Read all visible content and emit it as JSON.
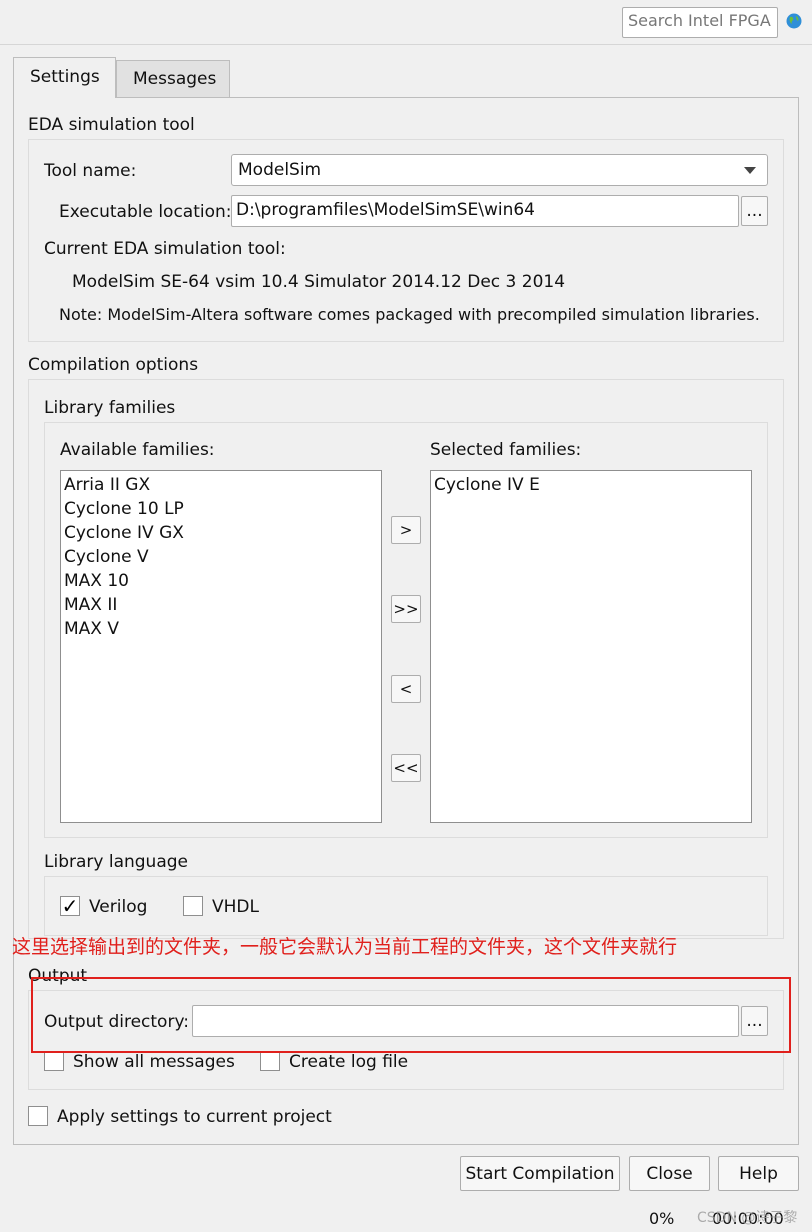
{
  "header": {
    "search_placeholder": "Search Intel FPGA"
  },
  "tabs": [
    {
      "label": "Settings",
      "active": true
    },
    {
      "label": "Messages",
      "active": false
    }
  ],
  "eda": {
    "title": "EDA simulation tool",
    "tool_name_label": "Tool name:",
    "tool_name_value": "ModelSim",
    "exec_label": "Executable location:",
    "exec_value": "D:\\programfiles\\ModelSimSE\\win64",
    "browse_label": "...",
    "current_label": "Current EDA simulation tool:",
    "current_value": "ModelSim SE-64 vsim 10.4 Simulator 2014.12 Dec  3 2014",
    "note": "Note: ModelSim-Altera software comes packaged with precompiled simulation libraries."
  },
  "compilation": {
    "title": "Compilation options",
    "library_families_title": "Library families",
    "available_label": "Available families:",
    "available": [
      "Arria II GX",
      "Cyclone 10 LP",
      "Cyclone IV GX",
      "Cyclone V",
      "MAX 10",
      "MAX II",
      "MAX V"
    ],
    "selected_label": "Selected families:",
    "selected": [
      "Cyclone IV E"
    ],
    "move_buttons": [
      ">",
      ">>",
      "<",
      "<<"
    ],
    "library_language_title": "Library language",
    "languages": [
      {
        "label": "Verilog",
        "checked": true
      },
      {
        "label": "VHDL",
        "checked": false
      }
    ]
  },
  "annotation": "这里选择输出到的文件夹，一般它会默认为当前工程的文件夹，这个文件夹就行",
  "output": {
    "title": "Output",
    "dir_label": "Output directory:",
    "dir_value": "",
    "browse_label": "...",
    "show_all_label": "Show all messages",
    "show_all_checked": false,
    "log_label": "Create log file",
    "log_checked": false
  },
  "apply": {
    "label": "Apply settings to current project",
    "checked": false
  },
  "footer": {
    "start_label": "Start Compilation",
    "close_label": "Close",
    "help_label": "Help",
    "progress": "0%",
    "time": "00:00:00",
    "watermark": "CSDN @诗子黎"
  }
}
